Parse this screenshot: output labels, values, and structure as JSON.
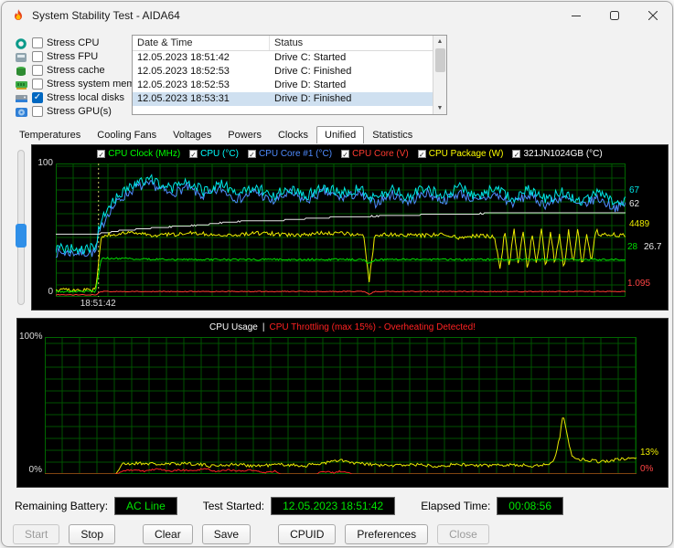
{
  "window": {
    "title": "System Stability Test - AIDA64"
  },
  "stress_options": {
    "items": [
      {
        "label": "Stress CPU",
        "checked": false,
        "icon": "cpu-icon"
      },
      {
        "label": "Stress FPU",
        "checked": false,
        "icon": "fpu-icon"
      },
      {
        "label": "Stress cache",
        "checked": false,
        "icon": "cache-icon"
      },
      {
        "label": "Stress system memory",
        "checked": false,
        "icon": "memory-icon"
      },
      {
        "label": "Stress local disks",
        "checked": true,
        "icon": "disk-icon"
      },
      {
        "label": "Stress GPU(s)",
        "checked": false,
        "icon": "gpu-icon"
      }
    ]
  },
  "log": {
    "columns": [
      "Date & Time",
      "Status"
    ],
    "rows": [
      {
        "datetime": "12.05.2023 18:51:42",
        "status": "Drive C: Started",
        "selected": false
      },
      {
        "datetime": "12.05.2023 18:52:53",
        "status": "Drive C: Finished",
        "selected": false
      },
      {
        "datetime": "12.05.2023 18:52:53",
        "status": "Drive D: Started",
        "selected": false
      },
      {
        "datetime": "12.05.2023 18:53:31",
        "status": "Drive D: Finished",
        "selected": true
      }
    ]
  },
  "tabs": {
    "items": [
      "Temperatures",
      "Cooling Fans",
      "Voltages",
      "Powers",
      "Clocks",
      "Unified",
      "Statistics"
    ],
    "active": "Unified"
  },
  "status": {
    "items": [
      {
        "label": "Remaining Battery:",
        "value": "AC Line"
      },
      {
        "label": "Test Started:",
        "value": "12.05.2023 18:51:42"
      },
      {
        "label": "Elapsed Time:",
        "value": "00:08:56"
      }
    ]
  },
  "buttons": {
    "left": [
      {
        "label": "Start",
        "disabled": true
      },
      {
        "label": "Stop",
        "disabled": false
      },
      {
        "label": "Clear",
        "disabled": false,
        "gap": true
      },
      {
        "label": "Save",
        "disabled": false
      },
      {
        "label": "CPUID",
        "disabled": false,
        "gap": true
      },
      {
        "label": "Preferences",
        "disabled": false
      }
    ],
    "close": {
      "label": "Close",
      "disabled": true
    }
  },
  "chart_data": [
    {
      "type": "line",
      "y_axis": {
        "max_label": "100",
        "min_label": "0"
      },
      "x_start_label": "18:51:42",
      "marker": {
        "x": 7.5,
        "color": "#cccc66"
      },
      "grid": {
        "dx": 19,
        "dy": 13,
        "color": "#005200",
        "frame": "#006600"
      },
      "legend": [
        {
          "label": "CPU Clock (MHz)",
          "color": "#00ff00"
        },
        {
          "label": "CPU (°C)",
          "color": "#00ffff"
        },
        {
          "label": "CPU Core #1 (°C)",
          "color": "#4f8cff"
        },
        {
          "label": "CPU Core (V)",
          "color": "#ff3b30"
        },
        {
          "label": "CPU Package (W)",
          "color": "#ffff00"
        },
        {
          "label": "321JN1024GB (°C)",
          "color": "#ffffff"
        }
      ],
      "right_values": [
        {
          "text": "67",
          "color": "#00e6e6",
          "top_pct": 20,
          "left": 4
        },
        {
          "text": "62",
          "color": "#e8e8e8",
          "top_pct": 30,
          "left": 4
        },
        {
          "text": "4489",
          "color": "#ecec00",
          "top_pct": 45,
          "left": 4
        },
        {
          "text": "28",
          "color": "#00dd00",
          "top_pct": 62,
          "left": 2
        },
        {
          "text": "26.7",
          "color": "#e8e8e8",
          "top_pct": 62,
          "left": 20
        },
        {
          "text": "1.095",
          "color": "#ff4444",
          "top_pct": 90,
          "left": 2
        }
      ],
      "series": [
        {
          "name": "cpu-core1-temp",
          "color": "#4f8cff",
          "noise": 3.5,
          "points": [
            [
              0,
              33
            ],
            [
              7,
              33
            ],
            [
              7.5,
              46
            ],
            [
              9,
              62
            ],
            [
              11,
              72
            ],
            [
              14,
              82
            ],
            [
              17,
              84
            ],
            [
              20,
              77
            ],
            [
              23,
              82
            ],
            [
              26,
              75
            ],
            [
              29,
              81
            ],
            [
              32,
              73
            ],
            [
              35,
              79
            ],
            [
              38,
              71
            ],
            [
              41,
              78
            ],
            [
              44,
              72
            ],
            [
              47,
              79
            ],
            [
              50,
              74
            ],
            [
              53,
              77
            ],
            [
              56,
              70
            ],
            [
              59,
              77
            ],
            [
              62,
              71
            ],
            [
              65,
              78
            ],
            [
              68,
              72
            ],
            [
              71,
              78
            ],
            [
              74,
              71
            ],
            [
              77,
              77
            ],
            [
              80,
              70
            ],
            [
              83,
              76
            ],
            [
              86,
              69
            ],
            [
              89,
              75
            ],
            [
              92,
              68
            ],
            [
              95,
              74
            ],
            [
              98,
              67
            ],
            [
              100,
              69
            ]
          ]
        },
        {
          "name": "cpu-temp",
          "color": "#00e6e6",
          "noise": 4,
          "points": [
            [
              0,
              36
            ],
            [
              7,
              36
            ],
            [
              7.5,
              50
            ],
            [
              9,
              66
            ],
            [
              11,
              76
            ],
            [
              14,
              86
            ],
            [
              17,
              88
            ],
            [
              20,
              81
            ],
            [
              23,
              86
            ],
            [
              26,
              79
            ],
            [
              29,
              85
            ],
            [
              32,
              77
            ],
            [
              35,
              83
            ],
            [
              38,
              75
            ],
            [
              41,
              82
            ],
            [
              44,
              76
            ],
            [
              47,
              83
            ],
            [
              50,
              78
            ],
            [
              53,
              81
            ],
            [
              56,
              74
            ],
            [
              59,
              81
            ],
            [
              62,
              75
            ],
            [
              65,
              82
            ],
            [
              68,
              76
            ],
            [
              71,
              82
            ],
            [
              74,
              75
            ],
            [
              77,
              81
            ],
            [
              80,
              74
            ],
            [
              83,
              80
            ],
            [
              86,
              73
            ],
            [
              89,
              79
            ],
            [
              92,
              72
            ],
            [
              95,
              78
            ],
            [
              98,
              71
            ],
            [
              100,
              73
            ]
          ]
        },
        {
          "name": "disk-temp",
          "color": "#e8e8e8",
          "noise": 0.2,
          "step": true,
          "points": [
            [
              0,
              47
            ],
            [
              7,
              47
            ],
            [
              9,
              48
            ],
            [
              12,
              50
            ],
            [
              15,
              51
            ],
            [
              18,
              52
            ],
            [
              22,
              53
            ],
            [
              26,
              54
            ],
            [
              30,
              56
            ],
            [
              34,
              57
            ],
            [
              38,
              57
            ],
            [
              42,
              58
            ],
            [
              46,
              59
            ],
            [
              50,
              60
            ],
            [
              54,
              60
            ],
            [
              58,
              61
            ],
            [
              62,
              61
            ],
            [
              66,
              62
            ],
            [
              72,
              62
            ],
            [
              78,
              63
            ],
            [
              100,
              63
            ]
          ]
        },
        {
          "name": "cpu-clock",
          "color": "#ecec00",
          "noise": 1.5,
          "points": [
            [
              0,
              5
            ],
            [
              7,
              5
            ],
            [
              8,
              46
            ],
            [
              12,
              48
            ],
            [
              18,
              46
            ],
            [
              24,
              48
            ],
            [
              30,
              46
            ],
            [
              36,
              48
            ],
            [
              42,
              46
            ],
            [
              47,
              48
            ],
            [
              52,
              47
            ],
            [
              54,
              46
            ],
            [
              55,
              12
            ],
            [
              56,
              46
            ],
            [
              60,
              47
            ],
            [
              64,
              46
            ],
            [
              68,
              47
            ],
            [
              71,
              44
            ],
            [
              74,
              46
            ],
            [
              77,
              45
            ],
            [
              78,
              20
            ],
            [
              78.8,
              50
            ],
            [
              79.6,
              22
            ],
            [
              80.4,
              52
            ],
            [
              81.2,
              24
            ],
            [
              82,
              50
            ],
            [
              82.8,
              20
            ],
            [
              83.6,
              48
            ],
            [
              84.4,
              24
            ],
            [
              85.2,
              52
            ],
            [
              86,
              22
            ],
            [
              86.8,
              50
            ],
            [
              87.6,
              24
            ],
            [
              88.4,
              48
            ],
            [
              89.2,
              20
            ],
            [
              90,
              50
            ],
            [
              90.8,
              24
            ],
            [
              91.6,
              52
            ],
            [
              92.4,
              22
            ],
            [
              93.2,
              48
            ],
            [
              94,
              26
            ],
            [
              94.8,
              50
            ],
            [
              95.6,
              46
            ],
            [
              97,
              47
            ],
            [
              100,
              46
            ]
          ]
        },
        {
          "name": "cpu-package",
          "color": "#00dd00",
          "noise": 0.7,
          "points": [
            [
              0,
              4
            ],
            [
              7,
              4
            ],
            [
              8,
              29
            ],
            [
              20,
              28
            ],
            [
              40,
              28
            ],
            [
              54,
              28
            ],
            [
              55,
              25
            ],
            [
              56,
              28
            ],
            [
              80,
              28
            ],
            [
              100,
              28
            ]
          ]
        },
        {
          "name": "cpu-core-voltage",
          "color": "#ff3b30",
          "noise": 0.3,
          "points": [
            [
              0,
              1.5
            ],
            [
              7,
              1.5
            ],
            [
              8,
              4
            ],
            [
              54,
              4
            ],
            [
              55,
              2
            ],
            [
              56,
              4
            ],
            [
              100,
              4
            ]
          ]
        }
      ]
    },
    {
      "type": "line",
      "title_left": "CPU Usage",
      "title_left_color": "#ffffff",
      "title_sep": "|",
      "title_right": "CPU Throttling (max 15%) - Overheating Detected!",
      "title_right_color": "#ff2222",
      "y_axis": {
        "max_label": "100%",
        "min_label": "0%"
      },
      "grid": {
        "dx": 19,
        "dy": 13,
        "color": "#005200",
        "frame": "#006600"
      },
      "right_values": [
        {
          "text": "13%",
          "color": "#ecec00",
          "top_pct": 84,
          "left": 4
        },
        {
          "text": "0%",
          "color": "#ff4444",
          "top_pct": 96,
          "left": 4
        }
      ],
      "series": [
        {
          "name": "cpu-usage",
          "color": "#e8e800",
          "noise": 1.2,
          "points": [
            [
              0,
              0
            ],
            [
              12,
              0
            ],
            [
              13,
              7
            ],
            [
              16,
              8
            ],
            [
              20,
              7
            ],
            [
              24,
              8
            ],
            [
              28,
              6
            ],
            [
              32,
              7
            ],
            [
              36,
              6
            ],
            [
              40,
              7
            ],
            [
              44,
              6
            ],
            [
              47,
              8
            ],
            [
              50,
              10
            ],
            [
              52,
              8
            ],
            [
              55,
              7
            ],
            [
              58,
              6
            ],
            [
              62,
              7
            ],
            [
              66,
              6
            ],
            [
              70,
              7
            ],
            [
              74,
              6
            ],
            [
              78,
              7
            ],
            [
              82,
              6
            ],
            [
              85,
              7
            ],
            [
              86,
              9
            ],
            [
              87,
              26
            ],
            [
              87.6,
              45
            ],
            [
              88.2,
              30
            ],
            [
              89,
              14
            ],
            [
              90,
              11
            ],
            [
              92,
              10
            ],
            [
              94,
              9
            ],
            [
              96,
              10
            ],
            [
              98,
              11
            ],
            [
              100,
              12
            ]
          ]
        },
        {
          "name": "cpu-throttling",
          "color": "#ff2222",
          "noise": 0.6,
          "points": [
            [
              0,
              0
            ],
            [
              12,
              0
            ],
            [
              13,
              2
            ],
            [
              15,
              3
            ],
            [
              17,
              2
            ],
            [
              19,
              4
            ],
            [
              21,
              2
            ],
            [
              23,
              3
            ],
            [
              25,
              2
            ],
            [
              27,
              4
            ],
            [
              29,
              2
            ],
            [
              31,
              3
            ],
            [
              33,
              2
            ],
            [
              35,
              3
            ],
            [
              37,
              1
            ],
            [
              39,
              2
            ],
            [
              40,
              0
            ],
            [
              46,
              0
            ],
            [
              47,
              2
            ],
            [
              49,
              1
            ],
            [
              50,
              2
            ],
            [
              52,
              0
            ],
            [
              100,
              0
            ]
          ]
        }
      ]
    }
  ]
}
